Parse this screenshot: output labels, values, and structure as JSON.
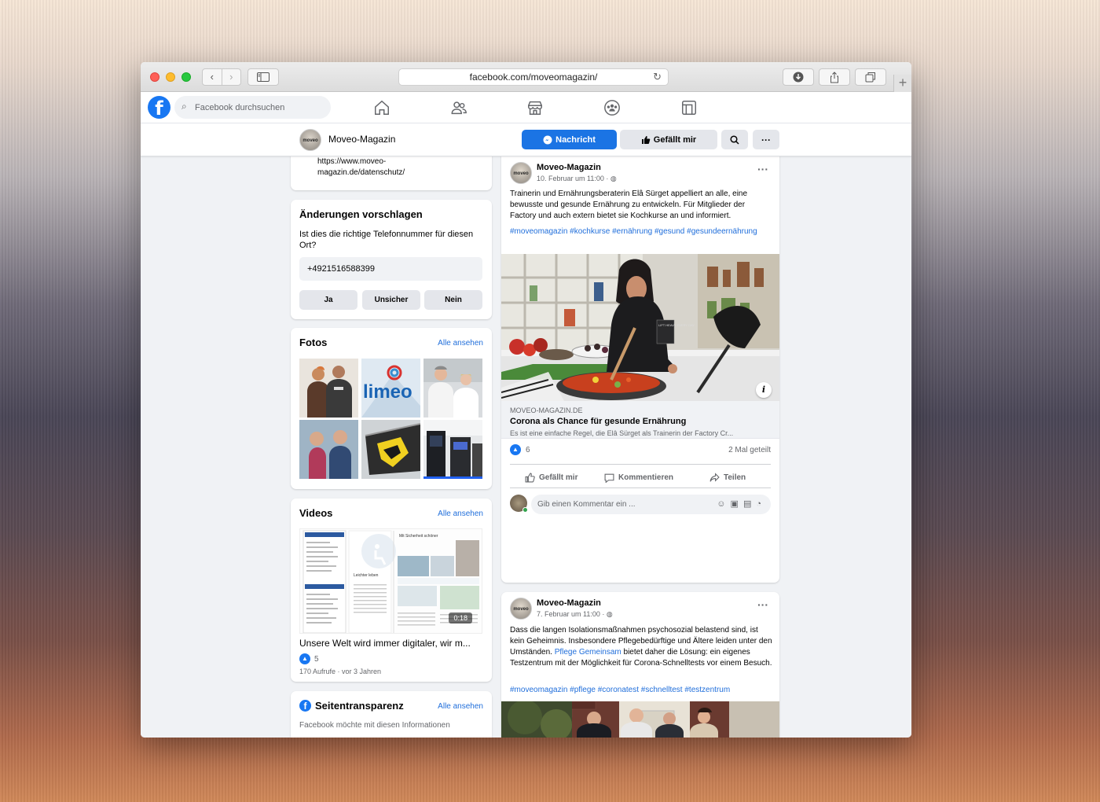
{
  "browser": {
    "url": "facebook.com/moveomagazin/"
  },
  "fb": {
    "search_placeholder": "Facebook durchsuchen"
  },
  "page": {
    "name": "Moveo-Magazin",
    "avatar_text": "moveo",
    "message_label": "Nachricht",
    "like_label": "Gefällt mir"
  },
  "about": {
    "privacy_url": "https://www.moveo-magazin.de/datenschutz/"
  },
  "suggest": {
    "title": "Änderungen vorschlagen",
    "question": "Ist dies die richtige Telefonnummer für diesen Ort?",
    "phone": "+4921516588399",
    "yes": "Ja",
    "unsure": "Unsicher",
    "no": "Nein"
  },
  "photos": {
    "title": "Fotos",
    "see_all": "Alle ansehen",
    "logo_text": "limeo"
  },
  "videos": {
    "title": "Videos",
    "see_all": "Alle ansehen",
    "duration": "0:18",
    "video_title": "Unsere Welt wird immer digitaler, wir m...",
    "likes": "5",
    "meta": "170 Aufrufe · vor 3 Jahren",
    "thumb_heading": "Mit Sicherheit schöner",
    "thumb_subheading": "Leichter leben"
  },
  "transparency": {
    "title": "Seitentransparenz",
    "see_all": "Alle ansehen",
    "text": "Facebook möchte mit diesen Informationen"
  },
  "posts": [
    {
      "author": "Moveo-Magazin",
      "date": "10. Februar um 11:00 · ",
      "text": "Trainerin und Ernährungsberaterin Elâ Sürget appelliert an alle, eine bewusste und gesunde Ernährung zu entwickeln. Für Mitglieder der Factory und auch extern bietet sie Kochkurse an und informiert.",
      "hashtags": "#moveomagazin #kochkurse #ernährung #gesund #gesundeernährung",
      "link_domain": "MOVEO-MAGAZIN.DE",
      "link_title": "Corona als Chance für gesunde Ernährung",
      "link_desc": "Es ist eine einfache Regel, die Elâ Sürget als Trainerin der Factory Cr...",
      "likes": "6",
      "shares": "2 Mal geteilt",
      "like_action": "Gefällt mir",
      "comment_action": "Kommentieren",
      "share_action": "Teilen",
      "comment_placeholder": "Gib einen Kommentar ein ...",
      "shirt_text": "LIFT HEAVY EVERY DAY"
    },
    {
      "author": "Moveo-Magazin",
      "date": "7. Februar um 11:00 · ",
      "text_before": "Dass die langen Isolationsmaßnahmen psychosozial belastend sind, ist kein Geheimnis. Insbesondere Pflegebedürftige und Ältere leiden unter den Umständen. ",
      "text_link": "Pflege Gemeinsam",
      "text_after": " bietet daher die Lösung: ein eigenes Testzentrum mit der Möglichkeit für Corona-Schnelltests vor einem Besuch.",
      "hashtags": "#moveomagazin #pflege #coronatest #schnelltest #testzentrum"
    }
  ],
  "colors": {
    "fb_blue": "#1877f2",
    "link_blue": "#216fdb",
    "bg_gray": "#f0f2f5"
  }
}
